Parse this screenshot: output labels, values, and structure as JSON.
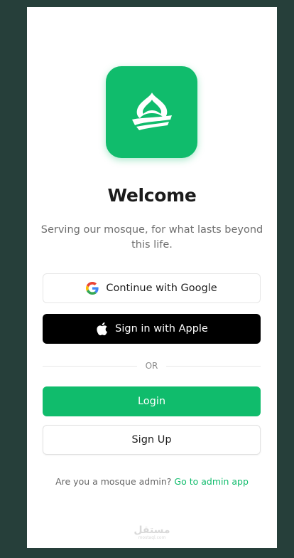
{
  "colors": {
    "brand": "#10bc6c",
    "background": "#263f3a",
    "apple": "#000000"
  },
  "logo": {
    "icon": "mosque-dome-icon"
  },
  "title": "Welcome",
  "subtitle": "Serving our mosque, for what lasts beyond this life.",
  "buttons": {
    "google": {
      "label": "Continue with Google",
      "icon": "google-icon"
    },
    "apple": {
      "label": "Sign in with Apple",
      "icon": "apple-icon"
    },
    "login": {
      "label": "Login"
    },
    "signup": {
      "label": "Sign Up"
    }
  },
  "divider": {
    "text": "OR"
  },
  "admin": {
    "prompt": "Are you a mosque admin?",
    "link": "Go to admin app"
  },
  "watermark": {
    "arabic": "مستقل",
    "latin": "mostaql.com"
  }
}
